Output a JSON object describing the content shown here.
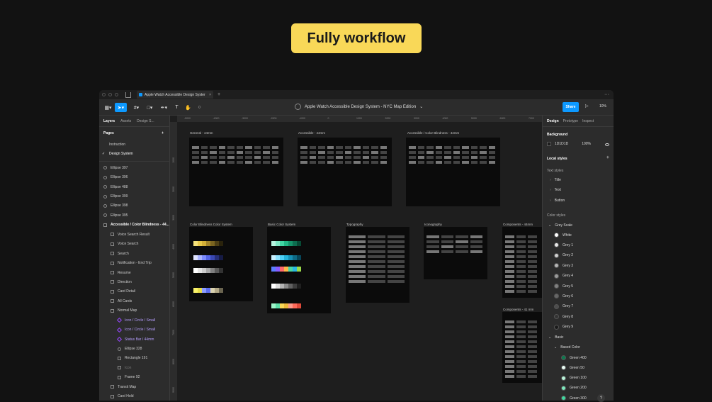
{
  "banner": "Fully workflow",
  "tab": {
    "title": "Apple Watch Accessible Design Syster",
    "close": "×",
    "add": "+"
  },
  "more": "···",
  "toolbar": {
    "doc_title": "Apple Watch Accessible Design System - NYC Map Edition",
    "chevron": "⌄",
    "share": "Share",
    "play": "▷",
    "zoom": "10%"
  },
  "left": {
    "tabs": [
      "Layers",
      "Assets",
      "Design S..."
    ],
    "pages_title": "Pages",
    "pages": [
      "Instruction",
      "Design System"
    ],
    "layers": [
      {
        "label": "Ellipse 397",
        "kind": "circ"
      },
      {
        "label": "Ellipse 396",
        "kind": "circ"
      },
      {
        "label": "Ellipse 488",
        "kind": "circ"
      },
      {
        "label": "Ellipse 399",
        "kind": "circ"
      },
      {
        "label": "Ellipse 398",
        "kind": "circ"
      },
      {
        "label": "Ellipse 395",
        "kind": "circ"
      },
      {
        "label": "Accessible / Color Blindness - 44...",
        "kind": "frame"
      },
      {
        "label": "Voice Search Result",
        "kind": "grid"
      },
      {
        "label": "Voice Search",
        "kind": "grid"
      },
      {
        "label": "Search",
        "kind": "grid"
      },
      {
        "label": "Notification - End Trip",
        "kind": "grid"
      },
      {
        "label": "Resume",
        "kind": "grid"
      },
      {
        "label": "Direction",
        "kind": "grid"
      },
      {
        "label": "Card Detail",
        "kind": "grid"
      },
      {
        "label": "All Cards",
        "kind": "grid"
      },
      {
        "label": "Normal Map",
        "kind": "grid"
      },
      {
        "label": "Icon / Circle / Small",
        "kind": "comp"
      },
      {
        "label": "Icon / Circle / Small",
        "kind": "comp"
      },
      {
        "label": "Status Bar / 44mm",
        "kind": "comp"
      },
      {
        "label": "Ellipse 328",
        "kind": "circ2"
      },
      {
        "label": "Rectangle 191",
        "kind": "rect2"
      },
      {
        "label": "Icon",
        "kind": "dim"
      },
      {
        "label": "Frame 92",
        "kind": "grid2"
      },
      {
        "label": "Transit Map",
        "kind": "grid"
      },
      {
        "label": "Card Hold",
        "kind": "grid"
      }
    ]
  },
  "ruler": {
    "top": [
      "-5000",
      "-4000",
      "-3000",
      "-2000",
      "-1000",
      "0",
      "1000",
      "2000",
      "3000",
      "4000",
      "5000",
      "6000",
      "7000"
    ],
    "left": [
      "1000",
      "2000",
      "3000",
      "4000",
      "5000",
      "6000",
      "7000",
      "8000",
      "9000"
    ]
  },
  "frames": [
    "General - 44mm",
    "Accessible - 44mm",
    "Accessible / Color Blindness - 44mm",
    "Color Blindness Color System",
    "Basic Color System",
    "Typography",
    "Iconography",
    "Components - 44mm",
    "Components - 41 mm"
  ],
  "right": {
    "tabs": [
      "Design",
      "Prototype",
      "Inspect"
    ],
    "background_title": "Background",
    "bg_hex": "1D1D1D",
    "bg_opacity": "100%",
    "local_styles": "Local styles",
    "text_styles_title": "Text styles",
    "text_styles": [
      "Title",
      "Text",
      "Button"
    ],
    "color_styles_title": "Color styles",
    "grey_scale": "Grey Scale",
    "greys": [
      "White",
      "Grey 1",
      "Grey 2",
      "Grey 3",
      "Grey 4",
      "Grey 5",
      "Grey 6",
      "Grey 7",
      "Grey 8",
      "Grey 9"
    ],
    "basic": "Basic",
    "based_color": "Based Color",
    "greens": [
      "Green 400",
      "Green 50",
      "Green 100",
      "Green 200",
      "Green 300"
    ]
  },
  "help": "?",
  "colors": {
    "accent": "#0d99ff",
    "banner": "#f9d858",
    "grey_swatches": [
      "#ffffff",
      "#e8e8e8",
      "#cfcfcf",
      "#b5b5b5",
      "#9a9a9a",
      "#808080",
      "#666666",
      "#4d4d4d",
      "#333333",
      "#1a1a1a"
    ],
    "green_swatches": [
      "#0c7a4f",
      "#e9fbf3",
      "#b9f3d9",
      "#7de8bd",
      "#3fd89f"
    ]
  }
}
